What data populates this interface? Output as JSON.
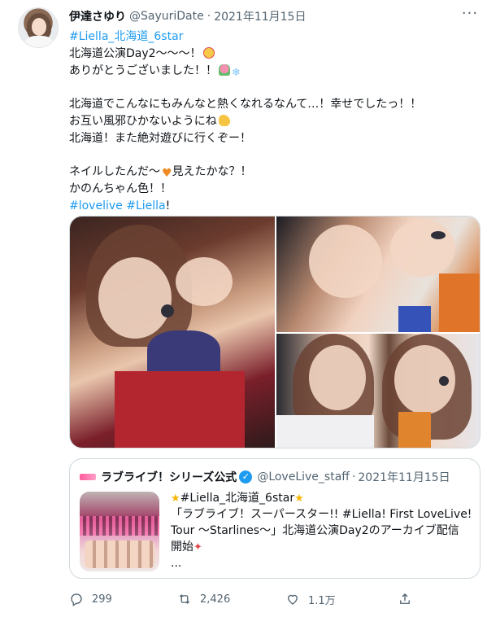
{
  "tweet": {
    "author_name": "伊達さゆり",
    "author_handle": "@SayuriDate",
    "separator": "·",
    "date": "2021年11月15日",
    "more_label": "···",
    "lines": [
      "#Liella_北海道_6star",
      "北海道公演Day2〜〜〜！",
      "ありがとうございました！！",
      "",
      "北海道でこんなにもみんなと熱くなれるなんて…！幸せでしたっ！！",
      "お互い風邪ひかないようにね",
      "北海道！また絶対遊びに行くぞー！",
      "",
      "ネイルしたんだ〜",
      "見えたかな？！",
      "かのんちゃん色！！",
      "#lovelive",
      "#Liella",
      "!"
    ],
    "emoji": [
      "smiling-face-with-hearts",
      "tulip",
      "snowflake",
      "flexed-biceps",
      "orange-heart"
    ],
    "link_color": "#1d9bf0"
  },
  "quote": {
    "author_name": "ラブライブ！シリーズ公式",
    "verified_mark": "✓",
    "author_handle": "@LoveLive_staff",
    "separator": "·",
    "date": "2021年11月15日",
    "lines": [
      "#Liella_北海道_6star",
      "「ラブライブ！スーパースター!! #Liella! First LoveLive!",
      "Tour 〜Starlines〜」北海道公演Day2のアーカイブ配信",
      "開始",
      "..."
    ]
  },
  "actions": {
    "reply_count": "299",
    "retweet_count": "2,426",
    "like_count": "1.1万"
  }
}
